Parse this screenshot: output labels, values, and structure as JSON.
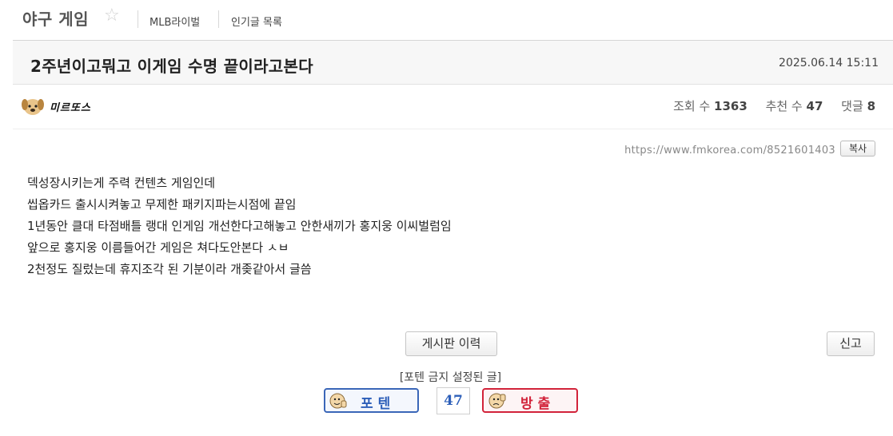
{
  "board": {
    "title": "야구 게임",
    "links": [
      "MLB라이벌",
      "인기글 목록"
    ]
  },
  "post": {
    "title": "2주년이고뭐고 이게임 수명 끝이라고본다",
    "date": "2025.06.14 15:11",
    "author_nickname": "미르또스",
    "stats": {
      "views_label": "조회 수",
      "views": "1363",
      "votes_label": "추천 수",
      "votes": "47",
      "comments_label": "댓글",
      "comments": "8"
    },
    "url": "https://www.fmkorea.com/8521601403",
    "copy_label": "복사",
    "body_lines": [
      "덱성장시키는게 주력 컨텐츠 게임인데",
      "씹옵카드 출시시켜놓고 무제한 패키지파는시점에 끝임",
      "1년동안 클대 타점배틀 랭대 인게임 개선한다고해놓고 안한새끼가 홍지웅 이씨벌럼임",
      "앞으로 홍지웅 이름들어간 게임은 쳐다도안본다 ㅅㅂ",
      "2천정도 질렀는데 휴지조각 된 기분이라 개좆같아서 글씀"
    ]
  },
  "actions": {
    "history_label": "게시판 이력",
    "report_label": "신고",
    "notice": "[포텐 금지 설정된 글]",
    "vote_up_label": "포텐",
    "vote_count": "47",
    "vote_down_label": "방출"
  },
  "colors": {
    "vote_up": "#2d5fb9",
    "vote_down": "#d2233a"
  }
}
